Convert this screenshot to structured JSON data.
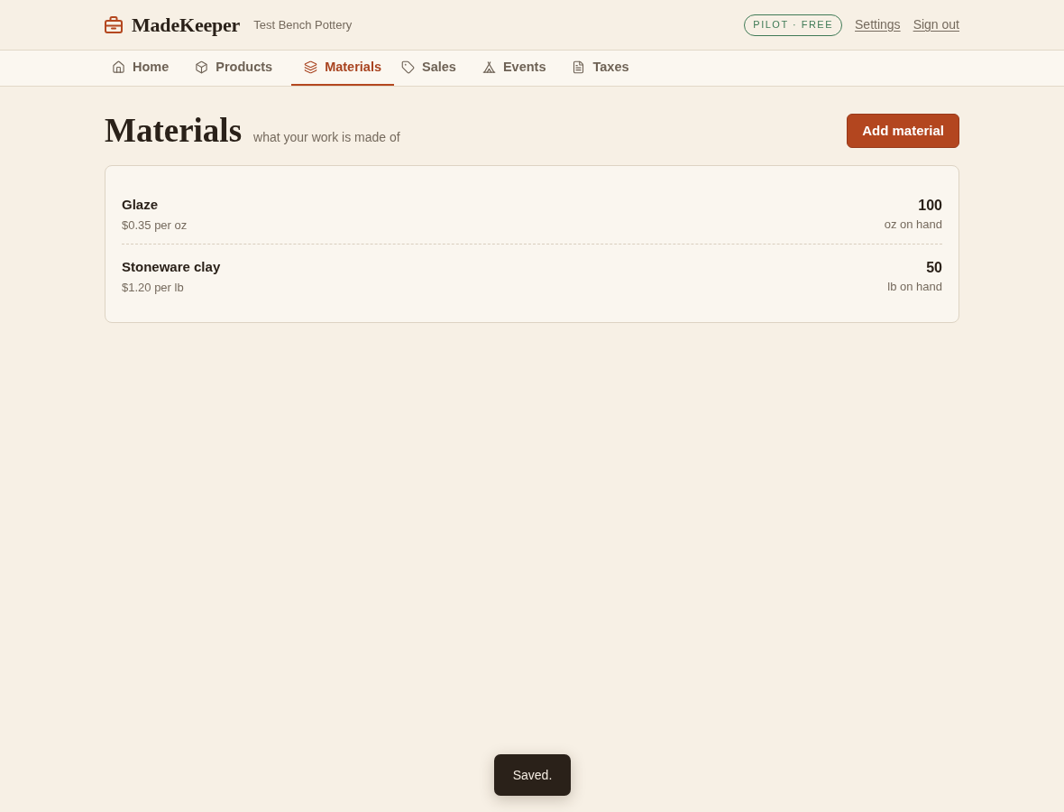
{
  "header": {
    "brand": "MadeKeeper",
    "workspace": "Test Bench Pottery",
    "plan_badge": "PILOT · FREE",
    "links": [
      "Settings",
      "Sign out"
    ]
  },
  "nav": {
    "tabs": [
      {
        "label": "Home",
        "kind": "home",
        "selected": false
      },
      {
        "label": "Products",
        "kind": "products",
        "selected": false
      },
      {
        "label": "Materials",
        "kind": "materials",
        "selected": true
      },
      {
        "label": "Sales",
        "kind": "sales",
        "selected": false
      },
      {
        "label": "Events",
        "kind": "events",
        "selected": false
      },
      {
        "label": "Taxes",
        "kind": "taxes",
        "selected": false
      }
    ]
  },
  "page": {
    "title": "Materials",
    "subtitle": "what your work is made of",
    "primary_button": "Add material"
  },
  "materials": [
    {
      "name": "Glaze",
      "cost": "$0.35 per oz",
      "quantity": "100",
      "quantity_label": "oz on hand"
    },
    {
      "name": "Stoneware clay",
      "cost": "$1.20 per lb",
      "quantity": "50",
      "quantity_label": "lb on hand"
    }
  ],
  "toast": {
    "message": "Saved."
  }
}
